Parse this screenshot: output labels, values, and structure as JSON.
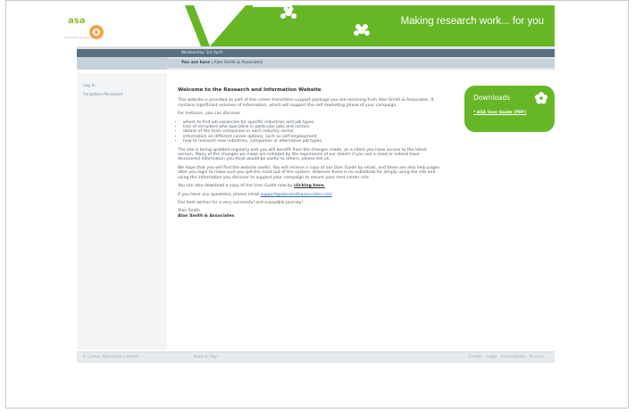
{
  "header": {
    "logo_text": "asa",
    "logo_sub": "Alan Smith & Associates",
    "tagline": "Making research work... for you"
  },
  "nav": {
    "date": "Wednesday 1st April",
    "breadcrumb_prefix": "You are here",
    "breadcrumb_sep": " | ",
    "breadcrumb_current": "Alan Smith & Associates"
  },
  "sidebar": {
    "items": [
      {
        "label": "Log In"
      },
      {
        "label": "Forgotten Password"
      }
    ]
  },
  "main": {
    "title": "Welcome to the Research and Information Website",
    "p1": "This website is provided as part of the career transitions support package you are receiving from Alan Smith & Associates. It contains significant volumes of information, which will support the self marketing phase of your campaign.",
    "p2": "For instance, you can discover",
    "bullets": [
      "where to find job vacancies for specific industries and job types",
      "lists of recruiters who specialise in particular jobs and sectors",
      "details of the main companies in each industry sector",
      "information on different career options, such as self employment",
      "how to research new industries, companies or alternative job types"
    ],
    "p3": "The site is being updated regularly and you will benefit from the changes made, as a client you have access to the latest version. Many of the changes we make are initiated by the experience of our clients if you see a need or indeed have discovered information you think would be useful to others, please tell us.",
    "p4": "We hope that you will find the website useful. You will receive a copy of our User Guide by email, and there are also help pages after you login to make sure you get the most out of the system. However there is no substitute for simply using the site and using the information you discover to support your campaign to secure your next career role.",
    "p5_prefix": "You can also download a copy of the User Guide now by",
    "p5_link": "clicking here.",
    "p6_prefix": "If you have any questions, please email",
    "p6_email": "support@alansmithassociates.com",
    "p7": "Our best wishes for a very successful and enjoyable journey!",
    "sig_name": "Alan Smith",
    "sig_company": "Alan Smith & Associates"
  },
  "downloads": {
    "title": "Downloads",
    "link": "* ASA User Guide (PDF)"
  },
  "footer": {
    "copyright": "© Career Workshop Limited",
    "back": "Back to Top",
    "right": "Credits . Legal . Accessibility . Privacy"
  },
  "colors": {
    "brand_green": "#67b626",
    "nav_dark": "#5b6f82",
    "nav_light": "#c7d1da"
  }
}
